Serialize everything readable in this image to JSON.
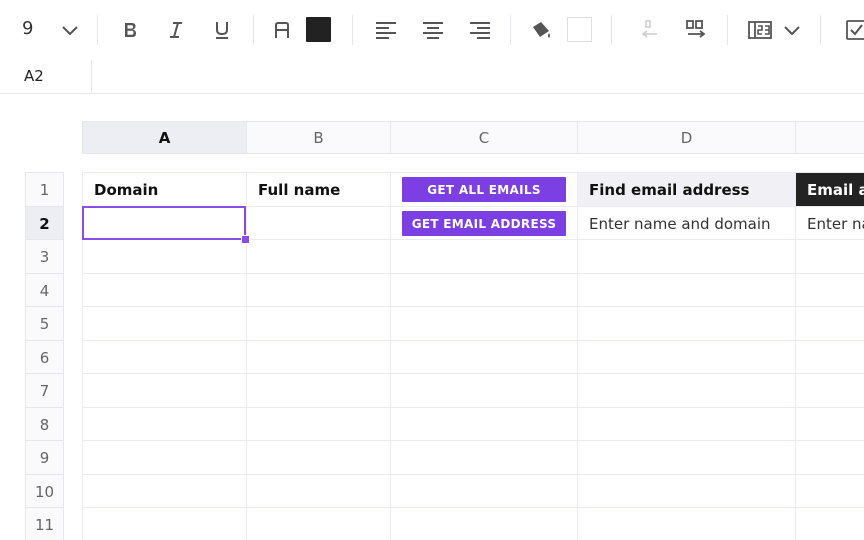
{
  "toolbar": {
    "font_size": "9",
    "tools": [
      {
        "name": "font-size-dropdown-icon",
        "icon": "chevron-down-icon"
      },
      {
        "name": "bold-icon"
      },
      {
        "name": "italic-icon"
      },
      {
        "name": "underline-icon"
      },
      {
        "name": "text-color-icon"
      },
      {
        "name": "align-left-icon"
      },
      {
        "name": "align-center-icon"
      },
      {
        "name": "align-right-icon"
      },
      {
        "name": "fill-color-icon"
      },
      {
        "name": "unmerge-icon"
      },
      {
        "name": "merge-icon"
      },
      {
        "name": "number-format-icon"
      },
      {
        "name": "checkbox-icon"
      }
    ],
    "text_color": "#222222",
    "fill_color": "#ffffff"
  },
  "formula_bar": {
    "cell_ref": "A2",
    "value": ""
  },
  "columns": [
    "A",
    "B",
    "C",
    "D"
  ],
  "active_column": "A",
  "rows": [
    "1",
    "2",
    "3",
    "4",
    "5",
    "6",
    "7",
    "8",
    "9",
    "10",
    "11"
  ],
  "active_row": "2",
  "cells": {
    "A1": "Domain",
    "B1": "Full name",
    "C1_button": "GET ALL EMAILS",
    "D1": "Find email address",
    "E1": "Email a",
    "A2": "",
    "B2": "",
    "C2_button": "GET EMAIL ADDRESS",
    "D2": "Enter name and domain",
    "E2": "Enter na"
  },
  "colors": {
    "accent": "#7b3fe4",
    "selection": "#8a4de8",
    "dark_header": "#232323",
    "grey_header": "#f0f0f5"
  }
}
